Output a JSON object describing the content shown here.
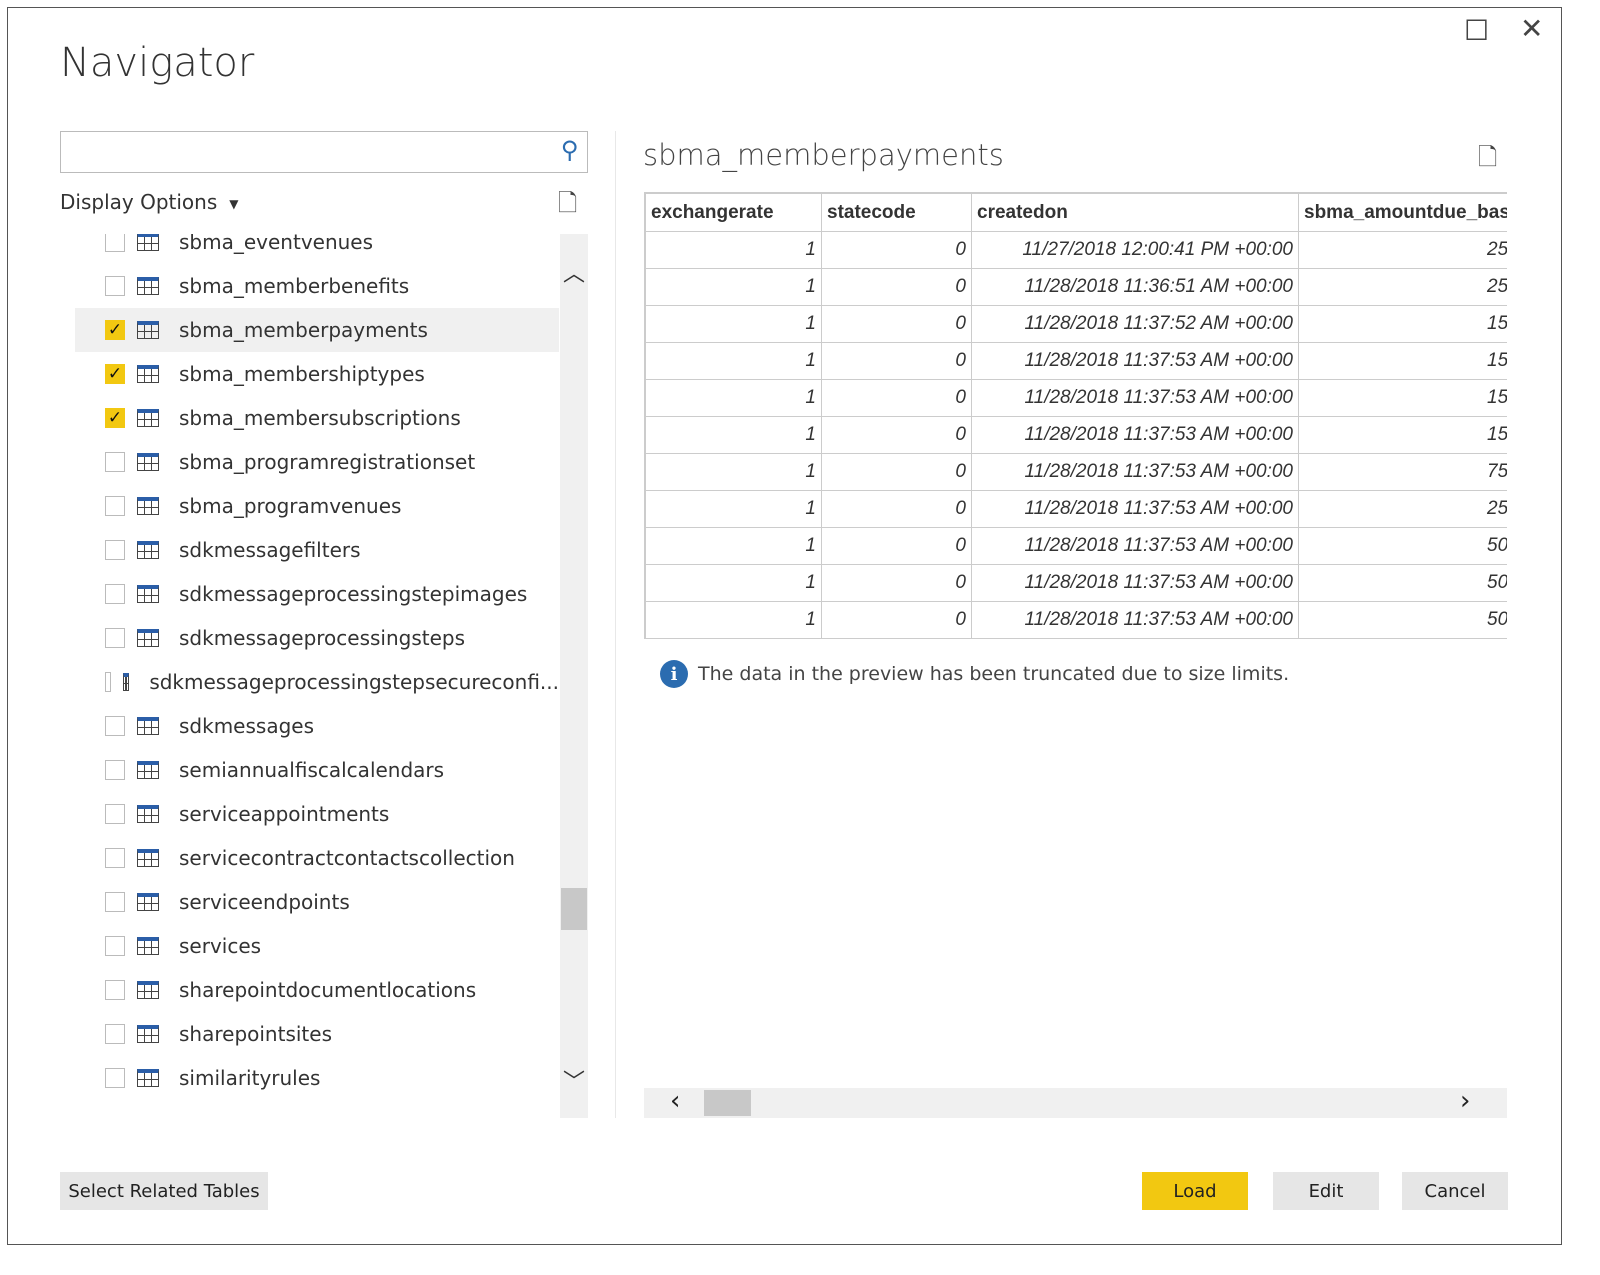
{
  "window": {
    "title": "Navigator",
    "maximize_icon": "maximize-icon",
    "close_icon": "close-icon"
  },
  "search": {
    "value": "",
    "placeholder": "",
    "icon": "search-icon"
  },
  "display_options": {
    "label": "Display Options"
  },
  "tables": [
    {
      "name": "sbma_eventvenues",
      "checked": false
    },
    {
      "name": "sbma_memberbenefits",
      "checked": false
    },
    {
      "name": "sbma_memberpayments",
      "checked": true,
      "selected": true
    },
    {
      "name": "sbma_membershiptypes",
      "checked": true
    },
    {
      "name": "sbma_membersubscriptions",
      "checked": true
    },
    {
      "name": "sbma_programregistrationset",
      "checked": false
    },
    {
      "name": "sbma_programvenues",
      "checked": false
    },
    {
      "name": "sdkmessagefilters",
      "checked": false
    },
    {
      "name": "sdkmessageprocessingstepimages",
      "checked": false
    },
    {
      "name": "sdkmessageprocessingsteps",
      "checked": false
    },
    {
      "name": "sdkmessageprocessingstepsecureconfi...",
      "checked": false
    },
    {
      "name": "sdkmessages",
      "checked": false
    },
    {
      "name": "semiannualfiscalcalendars",
      "checked": false
    },
    {
      "name": "serviceappointments",
      "checked": false
    },
    {
      "name": "servicecontractcontactscollection",
      "checked": false
    },
    {
      "name": "serviceendpoints",
      "checked": false
    },
    {
      "name": "services",
      "checked": false
    },
    {
      "name": "sharepointdocumentlocations",
      "checked": false
    },
    {
      "name": "sharepointsites",
      "checked": false
    },
    {
      "name": "similarityrules",
      "checked": false
    }
  ],
  "preview": {
    "title": "sbma_memberpayments",
    "columns": [
      "exchangerate",
      "statecode",
      "createdon",
      "sbma_amountdue_base"
    ],
    "rows": [
      [
        "1",
        "0",
        "11/27/2018 12:00:41 PM +00:00",
        "25"
      ],
      [
        "1",
        "0",
        "11/28/2018 11:36:51 AM +00:00",
        "25"
      ],
      [
        "1",
        "0",
        "11/28/2018 11:37:52 AM +00:00",
        "15"
      ],
      [
        "1",
        "0",
        "11/28/2018 11:37:53 AM +00:00",
        "15"
      ],
      [
        "1",
        "0",
        "11/28/2018 11:37:53 AM +00:00",
        "15"
      ],
      [
        "1",
        "0",
        "11/28/2018 11:37:53 AM +00:00",
        "15"
      ],
      [
        "1",
        "0",
        "11/28/2018 11:37:53 AM +00:00",
        "75"
      ],
      [
        "1",
        "0",
        "11/28/2018 11:37:53 AM +00:00",
        "25"
      ],
      [
        "1",
        "0",
        "11/28/2018 11:37:53 AM +00:00",
        "50"
      ],
      [
        "1",
        "0",
        "11/28/2018 11:37:53 AM +00:00",
        "50"
      ],
      [
        "1",
        "0",
        "11/28/2018 11:37:53 AM +00:00",
        "50"
      ]
    ],
    "info": "The data in the preview has been truncated due to size limits."
  },
  "buttons": {
    "select_related": "Select Related Tables",
    "load": "Load",
    "edit": "Edit",
    "cancel": "Cancel"
  },
  "colors": {
    "accent": "#f2c811",
    "info": "#2b6cb0"
  }
}
